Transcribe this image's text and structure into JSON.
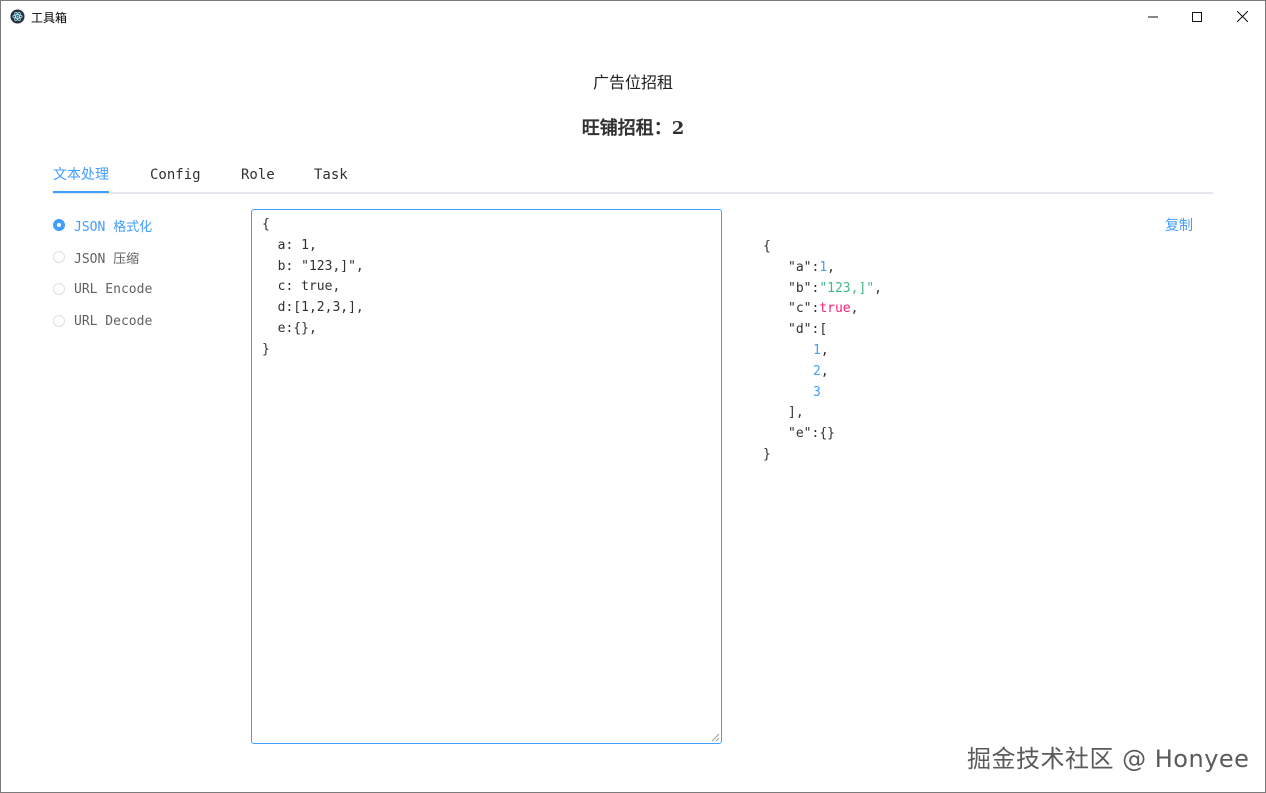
{
  "window": {
    "title": "工具箱",
    "controls": [
      "minimize-icon",
      "maximize-icon",
      "close-icon"
    ]
  },
  "ad": {
    "title": "广告位招租",
    "subtitle": "旺铺招租：2"
  },
  "tabs": [
    {
      "label": "文本处理",
      "active": true
    },
    {
      "label": "Config",
      "active": false
    },
    {
      "label": "Role",
      "active": false
    },
    {
      "label": "Task",
      "active": false
    }
  ],
  "options": [
    {
      "label": "JSON 格式化",
      "checked": true
    },
    {
      "label": "JSON 压缩",
      "checked": false
    },
    {
      "label": "URL Encode",
      "checked": false
    },
    {
      "label": "URL Decode",
      "checked": false
    }
  ],
  "editor": {
    "value": "{\n  a: 1,\n  b: \"123,]\",\n  c: true,\n  d:[1,2,3,],\n  e:{},\n}"
  },
  "output": {
    "copy_label": "复制",
    "lines": [
      {
        "indent": 0,
        "parts": [
          {
            "t": "{",
            "c": "p"
          }
        ]
      },
      {
        "indent": 1,
        "parts": [
          {
            "t": "\"a\"",
            "c": "k"
          },
          {
            "t": ":",
            "c": "p"
          },
          {
            "t": "1",
            "c": "num"
          },
          {
            "t": ",",
            "c": "p"
          }
        ]
      },
      {
        "indent": 1,
        "parts": [
          {
            "t": "\"b\"",
            "c": "k"
          },
          {
            "t": ":",
            "c": "p"
          },
          {
            "t": "\"123,]\"",
            "c": "str"
          },
          {
            "t": ",",
            "c": "p"
          }
        ]
      },
      {
        "indent": 1,
        "parts": [
          {
            "t": "\"c\"",
            "c": "k"
          },
          {
            "t": ":",
            "c": "p"
          },
          {
            "t": "true",
            "c": "bool"
          },
          {
            "t": ",",
            "c": "p"
          }
        ]
      },
      {
        "indent": 1,
        "parts": [
          {
            "t": "\"d\"",
            "c": "k"
          },
          {
            "t": ":",
            "c": "p"
          },
          {
            "t": "[",
            "c": "p"
          }
        ]
      },
      {
        "indent": 2,
        "parts": [
          {
            "t": "1",
            "c": "num"
          },
          {
            "t": ",",
            "c": "p"
          }
        ]
      },
      {
        "indent": 2,
        "parts": [
          {
            "t": "2",
            "c": "num"
          },
          {
            "t": ",",
            "c": "p"
          }
        ]
      },
      {
        "indent": 2,
        "parts": [
          {
            "t": "3",
            "c": "num"
          }
        ]
      },
      {
        "indent": 1,
        "parts": [
          {
            "t": "]",
            "c": "p"
          },
          {
            "t": ",",
            "c": "p"
          }
        ]
      },
      {
        "indent": 1,
        "parts": [
          {
            "t": "\"e\"",
            "c": "k"
          },
          {
            "t": ":",
            "c": "p"
          },
          {
            "t": "{}",
            "c": "p"
          }
        ]
      },
      {
        "indent": 0,
        "parts": [
          {
            "t": "}",
            "c": "p"
          }
        ]
      }
    ]
  },
  "watermark": "掘金技术社区 @ Honyee",
  "colors": {
    "accent": "#409eff",
    "string": "#42b983",
    "boolean": "#fc1e70",
    "text": "#303133"
  }
}
